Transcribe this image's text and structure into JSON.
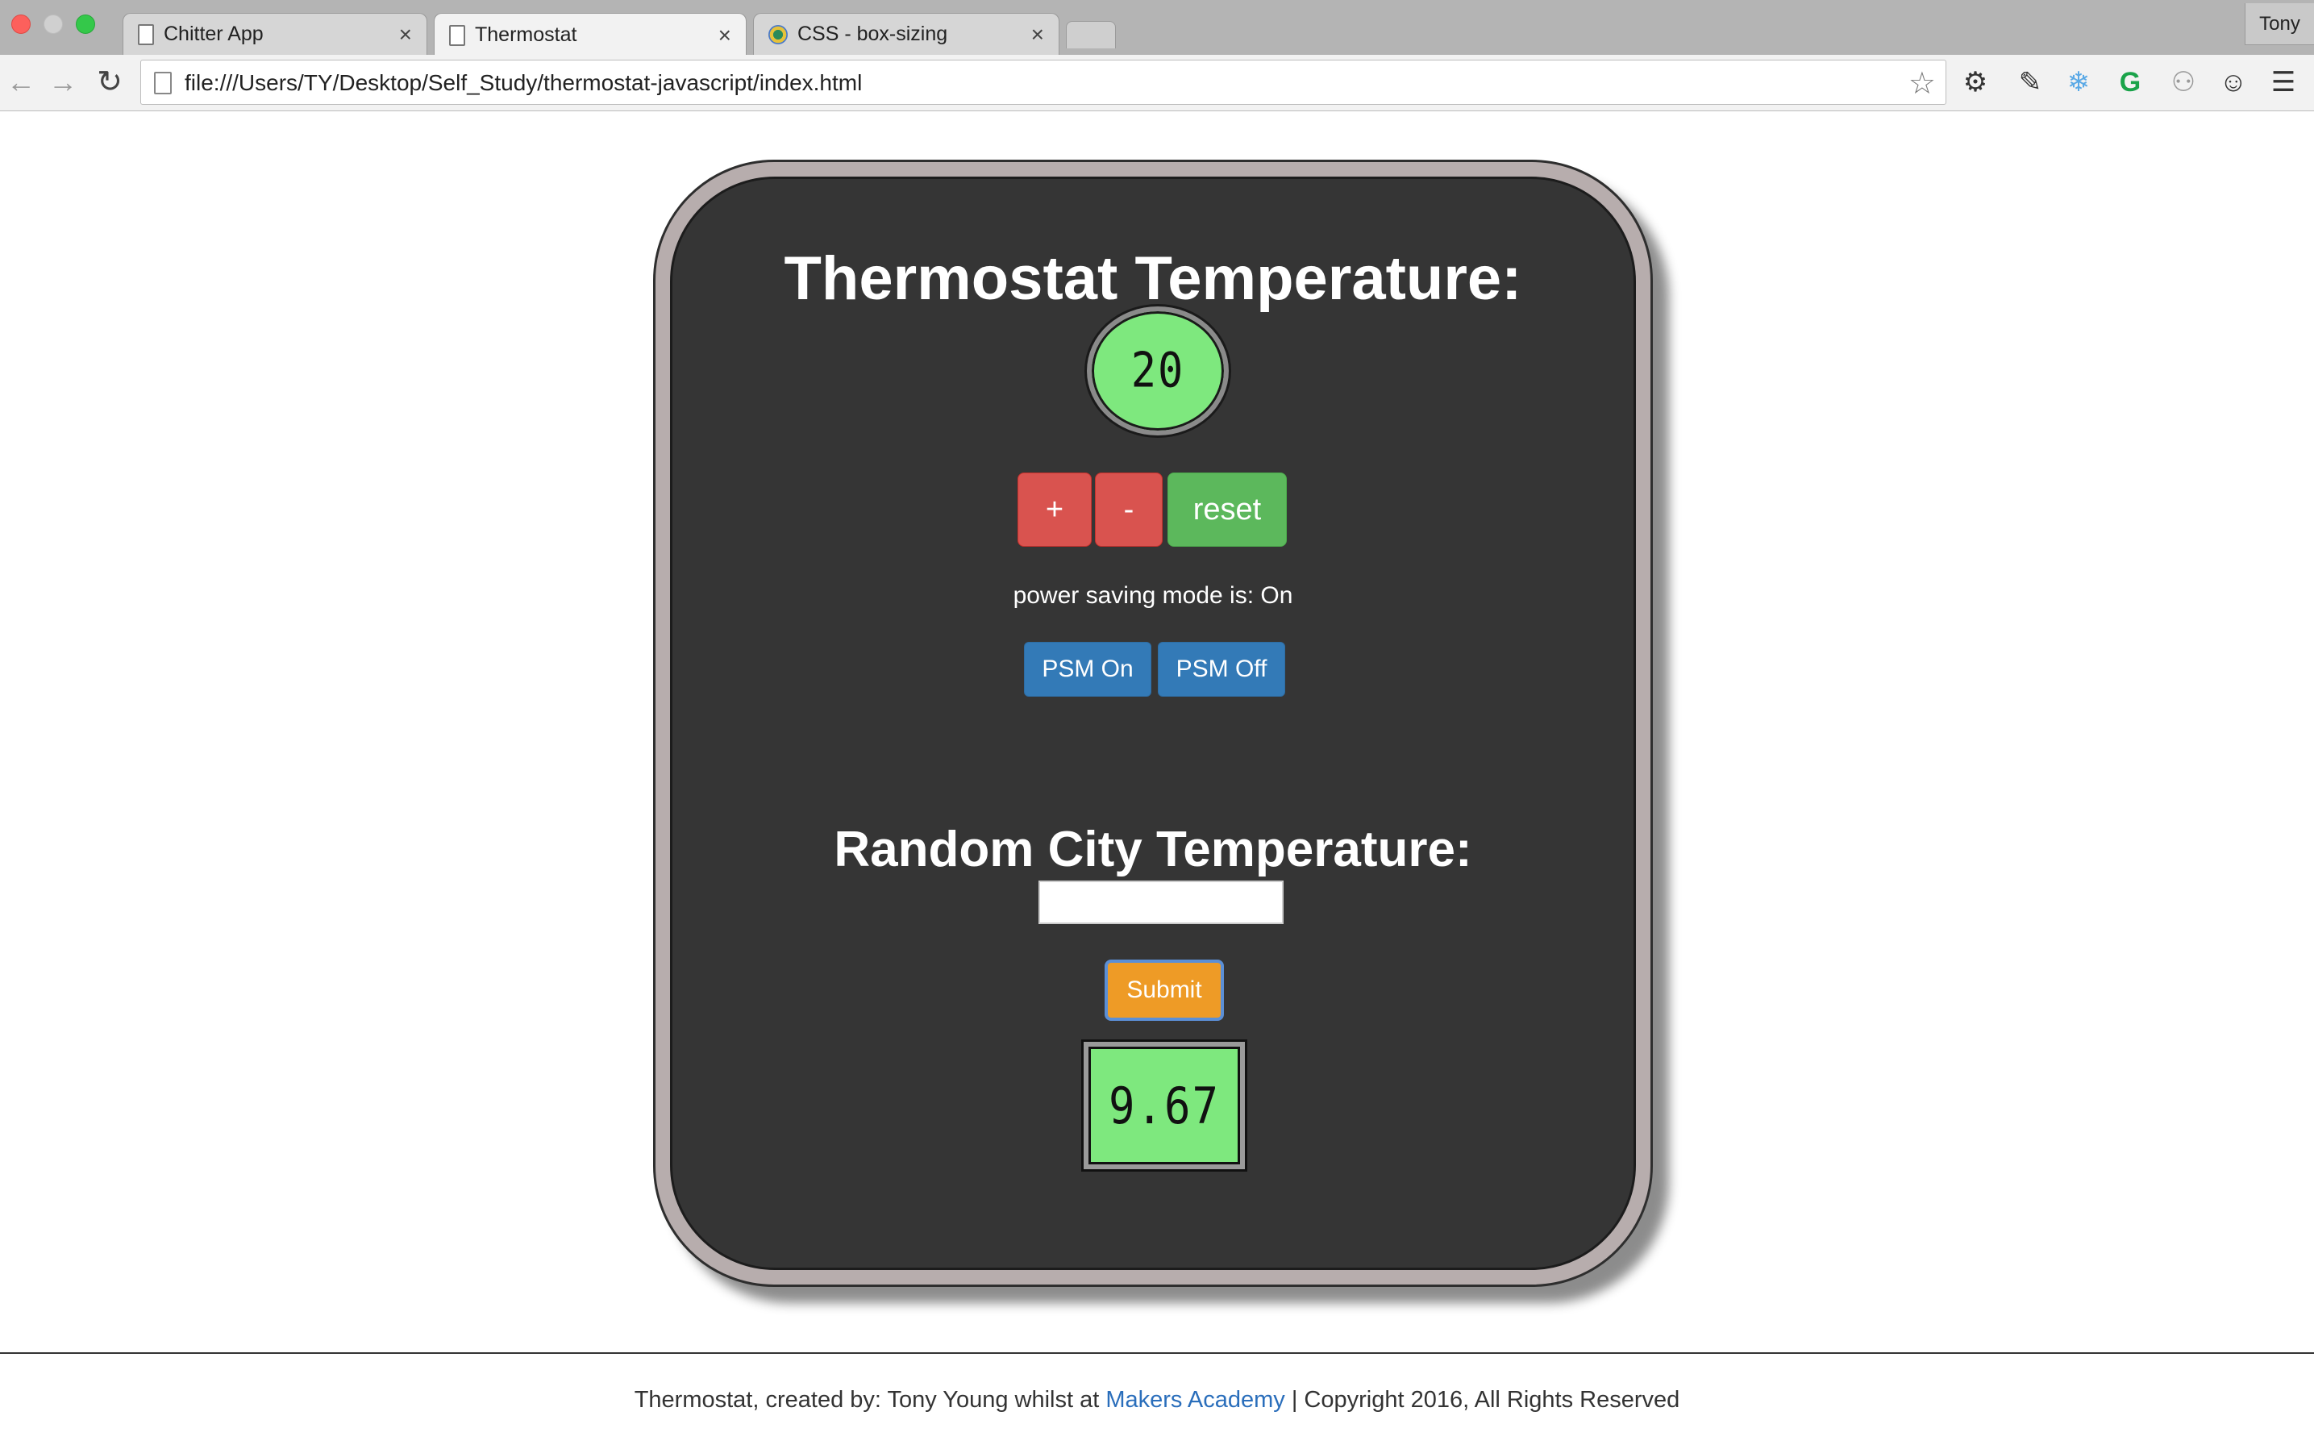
{
  "browser": {
    "tabs": [
      {
        "title": "Chitter App",
        "close": "×"
      },
      {
        "title": "Thermostat",
        "close": "×"
      },
      {
        "title": "CSS - box-sizing",
        "close": "×"
      }
    ],
    "profile_name": "Tony",
    "url": "file:///Users/TY/Desktop/Self_Study/thermostat-javascript/index.html",
    "icons": {
      "back": "←",
      "forward": "→",
      "reload": "↻",
      "star": "☆",
      "settings": "⚙",
      "eyedropper": "✎",
      "snowflake": "❄",
      "grammarly": "G",
      "share": "⚇",
      "panda": "☺",
      "menu": "☰"
    }
  },
  "thermostat": {
    "title": "Thermostat Temperature:",
    "temperature": "20",
    "buttons": {
      "up": "+",
      "down": "-",
      "reset": "reset"
    },
    "psm_label": "power saving mode is:",
    "psm_state": "On",
    "psm_buttons": {
      "on": "PSM On",
      "off": "PSM Off"
    }
  },
  "city": {
    "title": "Random City Temperature:",
    "input_value": "",
    "submit": "Submit",
    "temperature": "9.67"
  },
  "footer": {
    "prefix": "Thermostat, created by: Tony Young whilst at",
    "link": "Makers Academy",
    "suffix": "| Copyright 2016, All Rights Reserved"
  },
  "colors": {
    "lcd_green": "#7ee87e",
    "panel": "#353535",
    "red_button": "#d9534f",
    "green_button": "#5cb85c",
    "blue_button": "#337ab7",
    "orange_button": "#ee9b26",
    "link": "#2a6ebb"
  }
}
